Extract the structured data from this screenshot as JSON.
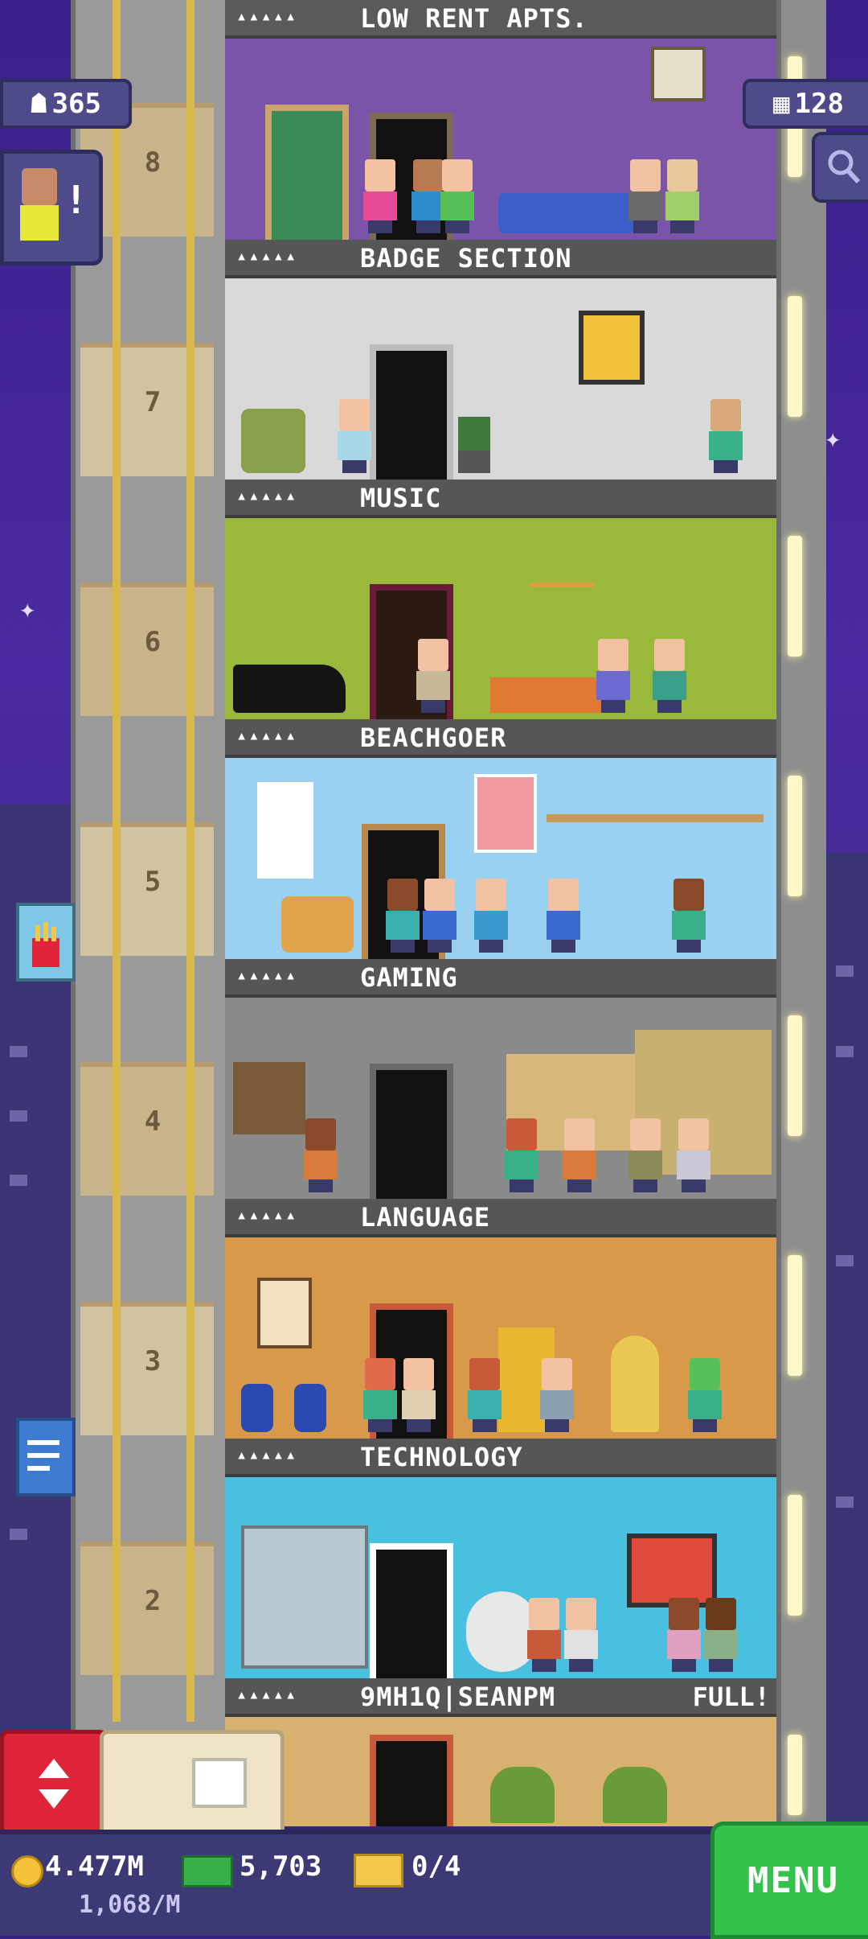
{
  "hud": {
    "population": "365",
    "floor_count": "128",
    "vip_alert": "!"
  },
  "shaft": {
    "floor_numbers": [
      "8",
      "7",
      "6",
      "5",
      "4",
      "3",
      "2"
    ]
  },
  "floors": [
    {
      "stars": "▴▴▴▴▴",
      "name": "LOW RENT APTS.",
      "status": ""
    },
    {
      "stars": "▴▴▴▴▴",
      "name": "BADGE SECTION",
      "status": ""
    },
    {
      "stars": "▴▴▴▴▴",
      "name": "MUSIC",
      "status": ""
    },
    {
      "stars": "▴▴▴▴▴",
      "name": "BEACHGOER",
      "status": ""
    },
    {
      "stars": "▴▴▴▴▴",
      "name": "GAMING",
      "status": ""
    },
    {
      "stars": "▴▴▴▴▴",
      "name": "LANGUAGE",
      "status": ""
    },
    {
      "stars": "▴▴▴▴▴",
      "name": "TECHNOLOGY",
      "status": ""
    },
    {
      "stars": "▴▴▴▴▴",
      "name": "9MH1Q|SEANPM",
      "status": "FULL!"
    }
  ],
  "bottom_bar": {
    "coins": "4.477M",
    "bux": "5,703",
    "tickets": "0/4",
    "income_rate": "1,068/M",
    "menu_label": "MENU"
  },
  "colors": {
    "menu_green": "#34c24c",
    "elevator_red": "#e0253a",
    "hud_purple": "#4d4b8a",
    "coin_gold": "#f5c23a"
  },
  "icons": [
    "population-icon",
    "floors-icon",
    "search-icon",
    "elevator-arrows-icon",
    "build-box-icon",
    "coin-icon",
    "bux-icon",
    "ticket-icon",
    "fries-icon",
    "document-icon"
  ]
}
